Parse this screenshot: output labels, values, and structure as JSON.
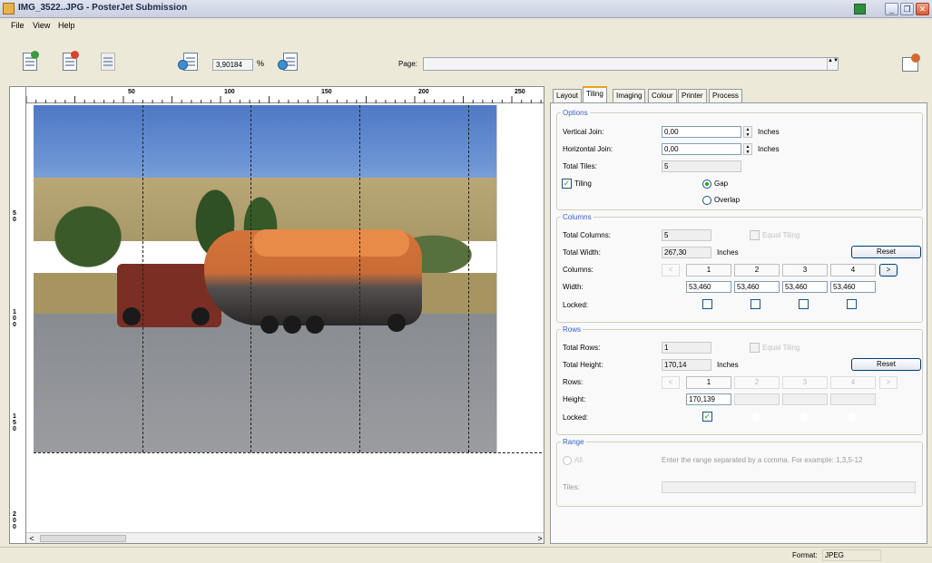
{
  "window": {
    "title": "IMG_3522..JPG - PosterJet Submission",
    "controls": {
      "minimize": "_",
      "restore": "❐",
      "close": "✕"
    }
  },
  "menu": [
    "File",
    "View",
    "Help"
  ],
  "toolbar": {
    "icons": [
      "add-file-icon",
      "remove-file-icon",
      "file-info-icon",
      "zoom-out-icon",
      "zoom-in-icon",
      "export-icon"
    ],
    "zoom_value": "3,90184",
    "zoom_unit": "%",
    "page_label": "Page:",
    "page_value": "",
    "spinner": "▲▼"
  },
  "ruler": {
    "top_labels": [
      "50",
      "100",
      "150",
      "200",
      "250"
    ],
    "left_labels": [
      "5\n0",
      "1\n0\n0",
      "1\n5\n0",
      "2\n0\n0"
    ]
  },
  "scrollbar": {
    "left_arrow": "<",
    "right_arrow": ">"
  },
  "tabs": [
    {
      "label": "Layout",
      "active": false
    },
    {
      "label": "Tiling",
      "active": true
    },
    {
      "label": "Imaging",
      "active": false
    },
    {
      "label": "Colour",
      "active": false
    },
    {
      "label": "Printer",
      "active": false
    },
    {
      "label": "Process",
      "active": false
    }
  ],
  "options": {
    "title": "Options",
    "vertical_join_label": "Vertical Join:",
    "vertical_join_value": "0,00",
    "horizontal_join_label": "Horizontal Join:",
    "horizontal_join_value": "0,00",
    "unit": "Inches",
    "total_tiles_label": "Total Tiles:",
    "total_tiles_value": "5",
    "tiling_label": "Tiling",
    "tiling_checked": true,
    "gap_label": "Gap",
    "overlap_label": "Overlap",
    "check_mark": "✓"
  },
  "columns": {
    "title": "Columns",
    "total_label": "Total Columns:",
    "total_value": "5",
    "equal_tiling_label": "Equal Tiling",
    "width_label": "Total Width:",
    "width_value": "267,30",
    "width_unit": "Inches",
    "reset_label": "Reset",
    "columns_label": "Columns:",
    "nav_prev": "<",
    "nav_next": ">",
    "col_numbers": [
      "1",
      "2",
      "3",
      "4"
    ],
    "col_width_label": "Width:",
    "col_widths": [
      "53,460",
      "53,460",
      "53,460",
      "53,460"
    ],
    "locked_label": "Locked:"
  },
  "rows": {
    "title": "Rows",
    "total_label": "Total Rows:",
    "total_value": "1",
    "equal_tiling_label": "Equal Tiling",
    "height_label": "Total Height:",
    "height_value": "170,14",
    "height_unit": "Inches",
    "reset_label": "Reset",
    "rows_label": "Rows:",
    "nav_prev": "<",
    "nav_next": ">",
    "row_numbers": [
      "1",
      "2",
      "3",
      "4"
    ],
    "row_height_label": "Height:",
    "row_height_value": "170,139",
    "locked_label": "Locked:",
    "check_mark": "✓"
  },
  "range": {
    "title": "Range",
    "all_label": "All",
    "hint": "Enter the range separated by a comma. For example: 1,3,5-12",
    "tiles_label": "Tiles:",
    "tiles_value": ""
  },
  "status": {
    "format_label": "Format:",
    "format_value": "JPEG"
  },
  "colors": {
    "accent_tab": "#e6a31e",
    "group_title": "#3a62c4",
    "check": "#21a121"
  }
}
